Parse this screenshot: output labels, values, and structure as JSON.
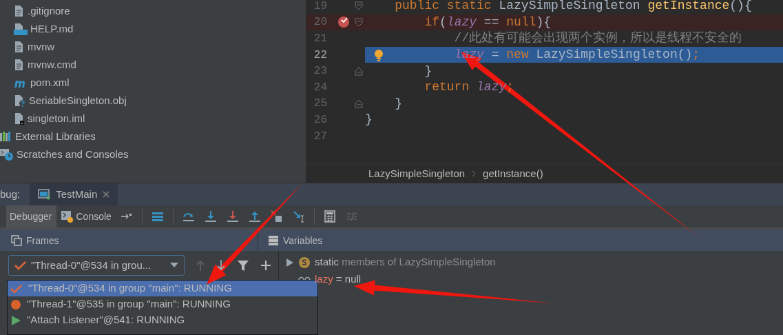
{
  "project_tree": {
    "files": [
      {
        "name": ".gitignore",
        "kind": "text"
      },
      {
        "name": "HELP.md",
        "kind": "markdown"
      },
      {
        "name": "mvnw",
        "kind": "text"
      },
      {
        "name": "mvnw.cmd",
        "kind": "text"
      },
      {
        "name": "pom.xml",
        "kind": "maven"
      },
      {
        "name": "SeriableSingleton.obj",
        "kind": "unknown"
      },
      {
        "name": "singleton.iml",
        "kind": "module"
      }
    ],
    "roots": [
      {
        "name": "External Libraries",
        "kind": "libraries"
      },
      {
        "name": "Scratches and Consoles",
        "kind": "scratches"
      }
    ]
  },
  "editor": {
    "lines": [
      {
        "number": "19",
        "kind": "fold_start",
        "breakpoint": false,
        "current": false,
        "tokens": [
          {
            "kind": "keyword",
            "text": "    public static "
          },
          {
            "kind": "plain",
            "text": "LazySimpleSingleton "
          },
          {
            "kind": "method",
            "text": "getInstance"
          },
          {
            "kind": "plain",
            "text": "(){"
          }
        ]
      },
      {
        "number": "20",
        "kind": "fold_start",
        "breakpoint": true,
        "current": false,
        "tokens": [
          {
            "kind": "keyword",
            "text": "        if"
          },
          {
            "kind": "plain",
            "text": "("
          },
          {
            "kind": "field",
            "text": "lazy"
          },
          {
            "kind": "plain",
            "text": " == "
          },
          {
            "kind": "keyword",
            "text": "null"
          },
          {
            "kind": "plain",
            "text": "){"
          }
        ]
      },
      {
        "number": "21",
        "breakpoint": false,
        "current": false,
        "tokens": [
          {
            "kind": "comment",
            "text": "            //此处有可能会出现两个实例，所以是线程不安全的"
          }
        ]
      },
      {
        "number": "22",
        "breakpoint": false,
        "current": true,
        "intention": true,
        "tokens": [
          {
            "kind": "field",
            "text": "            lazy"
          },
          {
            "kind": "plain",
            "text": " = "
          },
          {
            "kind": "keyword",
            "text": "new "
          },
          {
            "kind": "plain",
            "text": "LazySimpleSingleton()"
          },
          {
            "kind": "keyword",
            "text": ";"
          }
        ]
      },
      {
        "number": "23",
        "kind": "fold_end",
        "breakpoint": false,
        "current": false,
        "tokens": [
          {
            "kind": "plain",
            "text": "        }"
          }
        ]
      },
      {
        "number": "24",
        "breakpoint": false,
        "current": false,
        "tokens": [
          {
            "kind": "keyword",
            "text": "        return "
          },
          {
            "kind": "field",
            "text": "lazy"
          },
          {
            "kind": "keyword",
            "text": ";"
          }
        ]
      },
      {
        "number": "25",
        "kind": "fold_end",
        "breakpoint": false,
        "current": false,
        "tokens": [
          {
            "kind": "plain",
            "text": "    }"
          }
        ]
      },
      {
        "number": "26",
        "breakpoint": false,
        "current": false,
        "tokens": [
          {
            "kind": "plain",
            "text": "}"
          }
        ]
      },
      {
        "number": "27",
        "breakpoint": false,
        "current": false
      }
    ],
    "breadcrumb": [
      "LazySimpleSingleton",
      "getInstance()"
    ]
  },
  "debug": {
    "label": "bug:",
    "tabs": [
      {
        "label": "TestMain",
        "selected": true
      }
    ],
    "view_tabs": [
      {
        "label": "Debugger",
        "selected": true
      },
      {
        "label": "Console",
        "selected": false
      }
    ],
    "frames": {
      "title": "Frames",
      "thread_selector": "\"Thread-0\"@534 in grou...",
      "threads": [
        {
          "label": "\"Thread-0\"@534 in group \"main\": RUNNING",
          "kind": "current",
          "selected": true
        },
        {
          "label": "\"Thread-1\"@535 in group \"main\": RUNNING",
          "kind": "suspended",
          "selected": false
        },
        {
          "label": "\"Attach Listener\"@541: RUNNING",
          "kind": "running",
          "selected": false
        }
      ]
    },
    "variables": {
      "title": "Variables",
      "rows": [
        {
          "kind": "static",
          "name": "static",
          "value": "members of LazySimpleSingleton"
        },
        {
          "kind": "field",
          "name": "lazy",
          "value": "= null"
        }
      ]
    }
  }
}
